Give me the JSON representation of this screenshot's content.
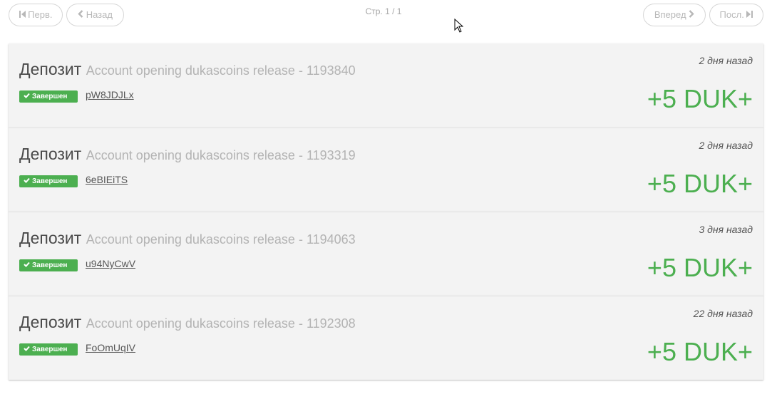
{
  "pagination": {
    "first_label": "Перв.",
    "prev_label": "Назад",
    "next_label": "Вперед",
    "last_label": "Посл.",
    "page_info": "Стр. 1 / 1"
  },
  "colors": {
    "success": "#4caf50",
    "card_bg": "#f3f3f3",
    "muted": "#b3b3b3"
  },
  "transactions": [
    {
      "type": "Депозит",
      "description": "Account opening dukascoins release - 1193840",
      "status": "Завершен",
      "code": "pW8JDJLx",
      "time": "2 дня назад",
      "amount": "+5 DUK+"
    },
    {
      "type": "Депозит",
      "description": "Account opening dukascoins release - 1193319",
      "status": "Завершен",
      "code": "6eBIEiTS",
      "time": "2 дня назад",
      "amount": "+5 DUK+"
    },
    {
      "type": "Депозит",
      "description": "Account opening dukascoins release - 1194063",
      "status": "Завершен",
      "code": "u94NyCwV",
      "time": "3 дня назад",
      "amount": "+5 DUK+"
    },
    {
      "type": "Депозит",
      "description": "Account opening dukascoins release - 1192308",
      "status": "Завершен",
      "code": "FoOmUqIV",
      "time": "22 дня назад",
      "amount": "+5 DUK+"
    }
  ]
}
